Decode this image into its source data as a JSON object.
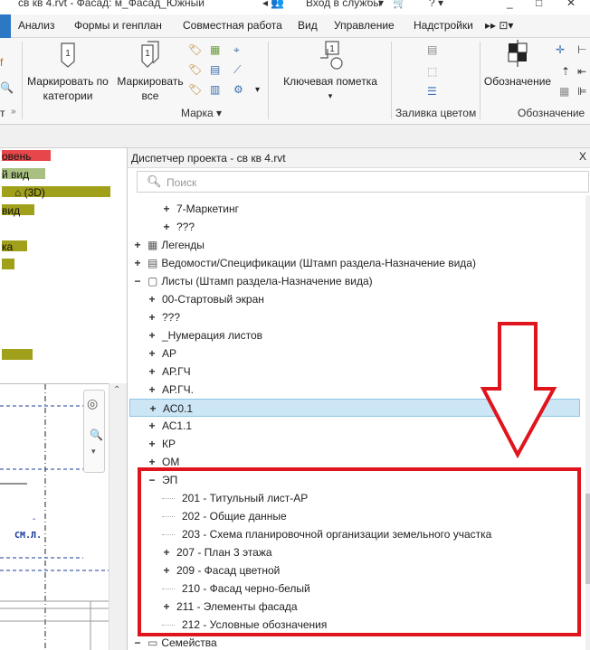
{
  "titlebar": {
    "title": "св кв 4.rvt - Фасад: м_Фасад_Южный",
    "signin": "Вход в службы"
  },
  "menu": {
    "tabs": [
      "Анализ",
      "Формы и генплан",
      "Совместная работа",
      "Вид",
      "Управление",
      "Надстройки"
    ]
  },
  "ribbon": {
    "tag_by_category": "Маркировать по категории",
    "tag_all": "Маркировать все",
    "keynote": "Ключевая пометка",
    "tag_group": "Марка",
    "color_fill_group": "Заливка цветом",
    "symbol": "Обозначение",
    "symbol_group": "Обозначение",
    "left_cut": "т"
  },
  "left_panel": {
    "tags": [
      "овень",
      "й вид",
      "(3D)",
      "вид",
      "ка",
      "",
      "",
      ""
    ],
    "view_label": "СМ.Л.",
    "view_dash": "-"
  },
  "browser": {
    "title": "Диспетчер проекта - св кв 4.rvt",
    "search_placeholder": "Поиск",
    "rows": [
      {
        "label": "7-Маркетинг",
        "exp": "+",
        "level": 2
      },
      {
        "label": "???",
        "exp": "+",
        "level": 2
      },
      {
        "label": "Легенды",
        "exp": "+",
        "level": 0
      },
      {
        "label": "Ведомости/Спецификации (Штамп раздела-Назначение вида)",
        "exp": "+",
        "level": 0
      },
      {
        "label": "Листы (Штамп раздела-Назначение вида)",
        "exp": "−",
        "level": 0
      },
      {
        "label": "00-Стартовый экран",
        "exp": "+",
        "level": 1
      },
      {
        "label": "???",
        "exp": "+",
        "level": 1
      },
      {
        "label": "_Нумерация листов",
        "exp": "+",
        "level": 1
      },
      {
        "label": "АР",
        "exp": "+",
        "level": 1
      },
      {
        "label": "АР.ГЧ",
        "exp": "+",
        "level": 1
      },
      {
        "label": "АР.ГЧ.",
        "exp": "+",
        "level": 1
      },
      {
        "label": "АС0.1",
        "exp": "+",
        "level": 1
      },
      {
        "label": "АС1.1",
        "exp": "+",
        "level": 1
      },
      {
        "label": "КР",
        "exp": "+",
        "level": 1
      },
      {
        "label": "ОМ",
        "exp": "+",
        "level": 1
      },
      {
        "label": "ЭП",
        "exp": "−",
        "level": 1
      },
      {
        "label": "201 - Титульный лист-АР",
        "exp": "",
        "level": 2
      },
      {
        "label": "202 - Общие данные",
        "exp": "",
        "level": 2
      },
      {
        "label": "203 - Схема планировочной организации земельного участка",
        "exp": "",
        "level": 2
      },
      {
        "label": "207 - План 3 этажа",
        "exp": "+",
        "level": 2
      },
      {
        "label": "209 - Фасад цветной",
        "exp": "+",
        "level": 2
      },
      {
        "label": "210 - Фасад черно-белый",
        "exp": "",
        "level": 2
      },
      {
        "label": "211 - Элементы фасада",
        "exp": "+",
        "level": 2
      },
      {
        "label": "212 - Условные обозначения",
        "exp": "",
        "level": 2
      },
      {
        "label": "Семейства",
        "exp": "−",
        "level": 0
      }
    ]
  }
}
